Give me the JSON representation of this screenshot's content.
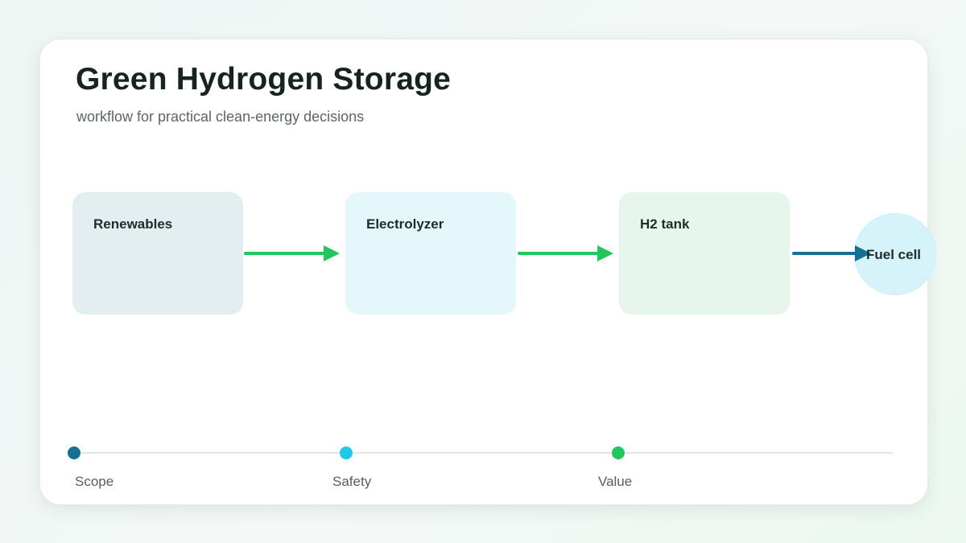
{
  "header": {
    "title": "Green Hydrogen Storage",
    "subtitle": "workflow for practical clean-energy decisions"
  },
  "flow": {
    "nodes": [
      {
        "label": "Renewables",
        "color": "#e2eef0"
      },
      {
        "label": "Electrolyzer",
        "color": "#e4f7fb"
      },
      {
        "label": "H2 tank",
        "color": "#e6f6ec"
      },
      {
        "label": "Fuel cell",
        "color": "#d6f3fa"
      }
    ],
    "arrow_colors": [
      "#22c55e",
      "#22c55e",
      "#16708f"
    ]
  },
  "timeline": {
    "milestones": [
      {
        "label": "Scope",
        "color": "#16708f"
      },
      {
        "label": "Safety",
        "color": "#22c7e6"
      },
      {
        "label": "Value",
        "color": "#22c55e"
      }
    ]
  }
}
